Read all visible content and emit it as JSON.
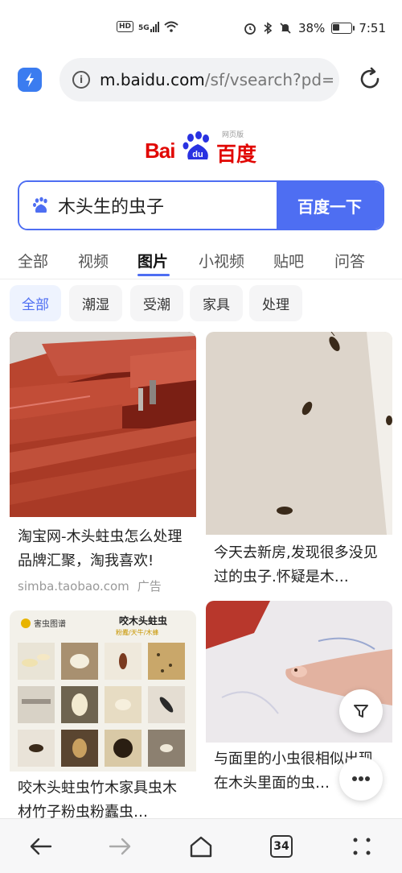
{
  "status": {
    "hd": "HD",
    "signal": "5G",
    "battery_percent": "38%",
    "battery_level": 0.38,
    "time": "7:51"
  },
  "browser": {
    "url_host": "m.baidu.com",
    "url_path": "/sf/vsearch?pd=",
    "tab_count": "34"
  },
  "logo": {
    "latin": "Bai",
    "du": "du",
    "chinese": "百度",
    "version": "网页版"
  },
  "search": {
    "query": "木头生的虫子",
    "button_label": "百度一下"
  },
  "tabs": [
    "全部",
    "视频",
    "图片",
    "小视频",
    "贴吧",
    "问答"
  ],
  "active_tab": "图片",
  "chips": [
    "全部",
    "潮湿",
    "受潮",
    "家具",
    "处理"
  ],
  "results": [
    {
      "title": "淘宝网-木头蛀虫怎么处理品牌汇聚，淘我喜欢!",
      "source": "simba.taobao.com",
      "badge": "广告"
    },
    {
      "title": "今天去新房,发现很多没见过的虫子.怀疑是木…"
    },
    {
      "title": "咬木头蛀虫竹木家具虫木材竹子粉虫粉蠹虫…",
      "image_header": "咬木头蛀虫",
      "image_sub": "粉蠹/天牛/木蜂",
      "image_brand": "害虫图谱"
    },
    {
      "title": "与面里的小虫很相似出现在木头里面的虫…"
    }
  ],
  "colors": {
    "brand_blue": "#4e6ef2",
    "brand_red": "#e10602"
  }
}
